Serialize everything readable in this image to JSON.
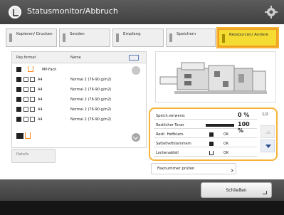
{
  "window": {
    "title": "Statusmonitor/Abbruch"
  },
  "tabs": [
    {
      "label": "Kopieren/ Drucken",
      "active": false
    },
    {
      "label": "Senden",
      "active": false
    },
    {
      "label": "Empfang",
      "active": false
    },
    {
      "label": "Speichern",
      "active": false
    },
    {
      "label": "Ressourcen/ Andere",
      "active": true
    }
  ],
  "joblist": {
    "headers": {
      "type": "Pap.format",
      "name": "Name"
    },
    "rows": [
      {
        "size": "MP-Fach",
        "type": ""
      },
      {
        "size": "A4",
        "type": "Normal 2 (76-90 g/m2)"
      },
      {
        "size": "A4",
        "type": "Normal 2 (76-90 g/m2)"
      },
      {
        "size": "A4",
        "type": "Normal 2 (76-90 g/m2)"
      },
      {
        "size": "A4",
        "type": "Normal 2 (76-90 g/m2)"
      },
      {
        "size": "A4",
        "type": "Normal 2 (76-90 g/m2)"
      }
    ],
    "details_label": "Details"
  },
  "consumables": {
    "rows": [
      {
        "label": "Speich.verwend.",
        "value": "",
        "big": "0 %"
      },
      {
        "label": "Restlicher Toner",
        "value": "",
        "big": "100 %"
      },
      {
        "label": "Restl. Heftklam.",
        "value": "OK",
        "big": ""
      },
      {
        "label": "Sattelheftklammern",
        "value": "OK",
        "big": ""
      },
      {
        "label": "Lochenabfall",
        "value": "OK",
        "big": ""
      }
    ],
    "page_indicator": "1/2"
  },
  "fax_button_label": "Faxnummer prüfen",
  "close_button_label": "Schließen",
  "colors": {
    "accent_orange": "#f6b236",
    "active_tab": "#f5dc33",
    "titlebar": "#4a4a4a"
  },
  "icons": [
    "status-monitor-icon",
    "gear-icon",
    "tray-icon",
    "scroll-up-icon",
    "scroll-down-icon",
    "page-up-arrow-icon",
    "page-down-arrow-icon",
    "enter-icon"
  ]
}
